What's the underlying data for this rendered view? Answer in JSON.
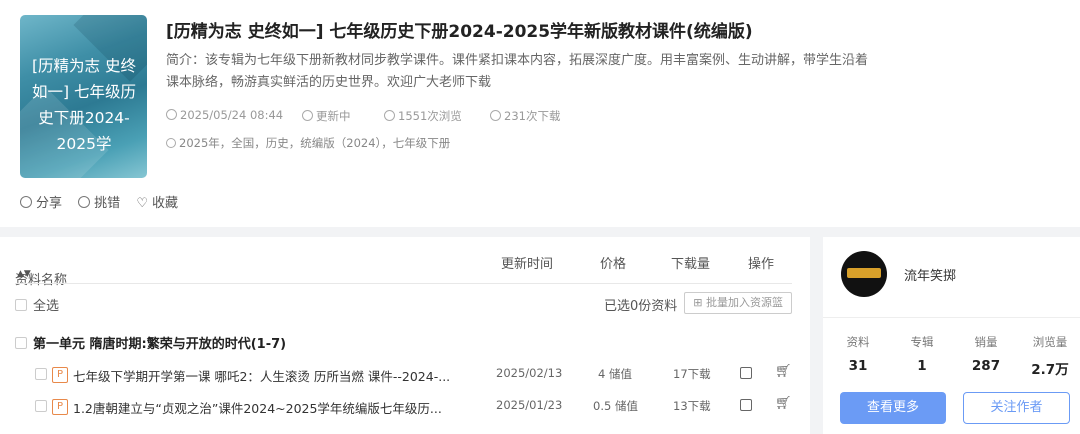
{
  "album": {
    "cover_text": "[历精为志 史终如一] 七年级历史下册2024-2025学",
    "title": "[历精为志 史终如一] 七年级历史下册2024-2025学年新版教材课件(统编版)",
    "intro": "简介：该专辑为七年级下册新教材同步教学课件。课件紧扣课本内容，拓展深度广度。用丰富案例、生动讲解，带学生沿着课本脉络，畅游真实鲜活的历史世界。欢迎广大老师下载",
    "date": "2025/05/24 08:44",
    "status": "更新中",
    "views": "1551次浏览",
    "downloads": "231次下载",
    "tags": "2025年，全国，历史，统编版（2024），七年级下册"
  },
  "actions": {
    "share": "分享",
    "report": "挑错",
    "favorite": "收藏"
  },
  "list": {
    "headers": {
      "name": "资料名称",
      "updated": "更新时间",
      "price": "价格",
      "downloads": "下载量",
      "ops": "操作"
    },
    "select_all": "全选",
    "selected_info": "已选0份资料",
    "batch_add": "批量加入资源篮",
    "unit_title": "第一单元 隋唐时期:繁荣与开放的时代(1-7)",
    "rows": [
      {
        "type": "P",
        "name": "七年级下学期开学第一课 哪吒2：人生滚烫 历所当燃 课件--2024-...",
        "date": "2025/02/13",
        "price": "4 储值",
        "downloads": "17下载"
      },
      {
        "type": "P",
        "name": "1.2唐朝建立与“贞观之治”课件2024~2025学年统编版七年级历...",
        "date": "2025/01/23",
        "price": "0.5 储值",
        "downloads": "13下载"
      }
    ]
  },
  "author": {
    "name": "流年笑掷",
    "stats": [
      {
        "label": "资料",
        "value": "31"
      },
      {
        "label": "专辑",
        "value": "1"
      },
      {
        "label": "销量",
        "value": "287"
      },
      {
        "label": "浏览量",
        "value": "2.7万"
      }
    ],
    "more_button": "查看更多",
    "follow_button": "关注作者"
  },
  "colors": {
    "accent": "#6b9bf5",
    "tag": "#e8894a"
  }
}
